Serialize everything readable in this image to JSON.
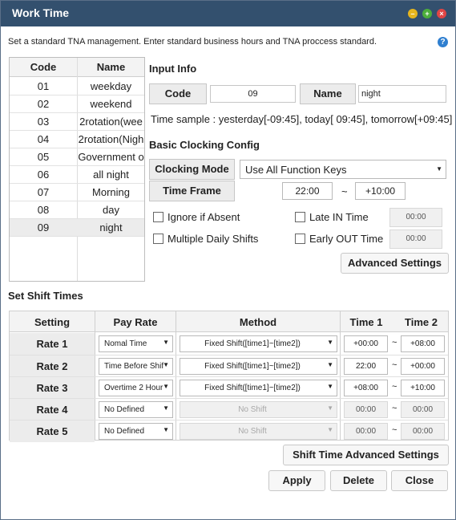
{
  "window": {
    "title": "Work Time"
  },
  "description": "Set a standard TNA management. Enter standard business hours and TNA proccess standard.",
  "code_list": {
    "headers": [
      "Code",
      "Name"
    ],
    "rows": [
      {
        "code": "01",
        "name": "weekday"
      },
      {
        "code": "02",
        "name": "weekend"
      },
      {
        "code": "03",
        "name": "2rotation(wee"
      },
      {
        "code": "04",
        "name": "2rotation(Nigh"
      },
      {
        "code": "05",
        "name": "Government o"
      },
      {
        "code": "06",
        "name": "all night"
      },
      {
        "code": "07",
        "name": "Morning"
      },
      {
        "code": "08",
        "name": "day"
      },
      {
        "code": "09",
        "name": "night"
      }
    ]
  },
  "input_info": {
    "section": "Input Info",
    "code_label": "Code",
    "code_value": "09",
    "name_label": "Name",
    "name_value": "night",
    "time_sample": "Time sample : yesterday[-09:45], today[ 09:45], tomorrow[+09:45]"
  },
  "clocking": {
    "section": "Basic Clocking Config",
    "mode_label": "Clocking Mode",
    "mode_value": "Use All Function Keys",
    "frame_label": "Time Frame",
    "frame_start": "22:00",
    "frame_sep": "~",
    "frame_end": "+10:00",
    "ignore_absent": "Ignore if Absent",
    "multiple_shifts": "Multiple Daily Shifts",
    "late_in": "Late IN Time",
    "late_in_value": "00:00",
    "early_out": "Early OUT Time",
    "early_out_value": "00:00",
    "advanced": "Advanced Settings"
  },
  "shift": {
    "section": "Set Shift Times",
    "headers": [
      "Setting",
      "Pay Rate",
      "Method",
      "Time 1",
      "Time 2"
    ],
    "rows": [
      {
        "setting": "Rate 1",
        "pay": "Nomal Time",
        "method": "Fixed Shift([time1]~[time2])",
        "t1": "+00:00",
        "t2": "+08:00",
        "enabled": true
      },
      {
        "setting": "Rate 2",
        "pay": "Time Before Shif",
        "method": "Fixed Shift([time1]~[time2])",
        "t1": "22:00",
        "t2": "+00:00",
        "enabled": true
      },
      {
        "setting": "Rate 3",
        "pay": "Overtime 2 Hour",
        "method": "Fixed Shift([time1]~[time2])",
        "t1": "+08:00",
        "t2": "+10:00",
        "enabled": true
      },
      {
        "setting": "Rate 4",
        "pay": "No Defined",
        "method": "No Shift",
        "t1": "00:00",
        "t2": "00:00",
        "enabled": false
      },
      {
        "setting": "Rate 5",
        "pay": "No Defined",
        "method": "No Shift",
        "t1": "00:00",
        "t2": "00:00",
        "enabled": false
      }
    ],
    "tilde": "~",
    "advanced": "Shift Time Advanced Settings"
  },
  "buttons": {
    "apply": "Apply",
    "delete": "Delete",
    "close": "Close"
  }
}
